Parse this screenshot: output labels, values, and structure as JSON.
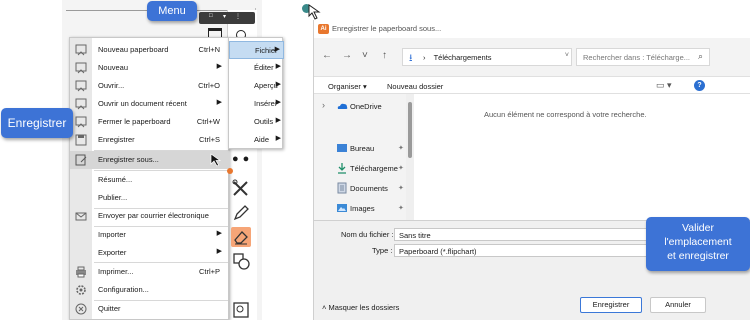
{
  "app": {
    "top_tab_glyphs": [
      "□",
      "▾",
      "⋮"
    ]
  },
  "menu": {
    "items": [
      {
        "label": "Nouveau paperboard",
        "shortcut": "Ctrl+N",
        "icon": "new-flipchart-icon"
      },
      {
        "label": "Nouveau",
        "arrow": "▶",
        "icon": "new-flipchart-icon"
      },
      {
        "label": "Ouvrir...",
        "shortcut": "Ctrl+O",
        "icon": "open-flipchart-icon"
      },
      {
        "label": "Ouvrir un document récent",
        "arrow": "▶",
        "icon": "recent-flipchart-icon"
      },
      {
        "label": "Fermer le paperboard",
        "shortcut": "Ctrl+W",
        "icon": "close-flipchart-icon"
      },
      {
        "label": "Enregistrer",
        "shortcut": "Ctrl+S",
        "icon": "save-icon"
      },
      {
        "label": "Enregistrer sous...",
        "icon": "save-as-icon"
      },
      {
        "label": "Résumé..."
      },
      {
        "label": "Publier..."
      },
      {
        "label": "Envoyer par courrier électronique",
        "icon": "mail-icon"
      },
      {
        "label": "Importer",
        "arrow": "▶"
      },
      {
        "label": "Exporter",
        "arrow": "▶"
      },
      {
        "label": "Imprimer...",
        "shortcut": "Ctrl+P",
        "icon": "printer-icon"
      },
      {
        "label": "Configuration...",
        "icon": "gear-icon"
      },
      {
        "label": "Quitter",
        "icon": "close-circle-icon"
      }
    ]
  },
  "submenu": {
    "items": [
      {
        "label": "Fichier",
        "arrow": "▶"
      },
      {
        "label": "Éditer",
        "arrow": "▶"
      },
      {
        "label": "Aperçu",
        "arrow": "▶"
      },
      {
        "label": "Insérer",
        "arrow": "▶"
      },
      {
        "label": "Outils",
        "arrow": "▶"
      },
      {
        "label": "Aide",
        "arrow": "▶"
      }
    ]
  },
  "callouts": {
    "menu": "Menu",
    "save": "Enregistrer",
    "validate": [
      "Valider",
      "l'emplacement",
      "et enregistrer"
    ]
  },
  "dialog": {
    "app_icon_text": "Ai",
    "title": "Enregistrer le paperboard sous...",
    "address": {
      "separator": "›",
      "folder": "Téléchargements",
      "dropdown": "˅"
    },
    "search_placeholder": "Rechercher dans : Télécharge...",
    "nav_glyphs": [
      "←",
      "→",
      "˅",
      "↑"
    ],
    "organize": "Organiser ▾",
    "new_folder": "Nouveau dossier",
    "view_glyph": "▭ ▾",
    "help_glyph": "?",
    "nav_pane": [
      {
        "label": "OneDrive",
        "icon": "onedrive-icon",
        "expander": "›"
      },
      {
        "label": "Bureau",
        "icon": "desktop-folder-icon",
        "pinned": true
      },
      {
        "label": "Téléchargeme",
        "icon": "downloads-icon",
        "pinned": true
      },
      {
        "label": "Documents",
        "icon": "documents-icon",
        "pinned": true
      },
      {
        "label": "Images",
        "icon": "images-icon",
        "pinned": true
      }
    ],
    "empty_message": "Aucun élément ne correspond à votre recherche.",
    "filename_label": "Nom du fichier :",
    "filename_value": "Sans titre",
    "type_label": "Type :",
    "type_value": "Paperboard (*.flipchart)",
    "hide_folders": "˄ Masquer les dossiers",
    "save_button": "Enregistrer",
    "cancel_button": "Annuler"
  },
  "colors": {
    "accent": "#3d73d6",
    "orange": "#e8772e",
    "highlight": "#c5dcf2"
  }
}
